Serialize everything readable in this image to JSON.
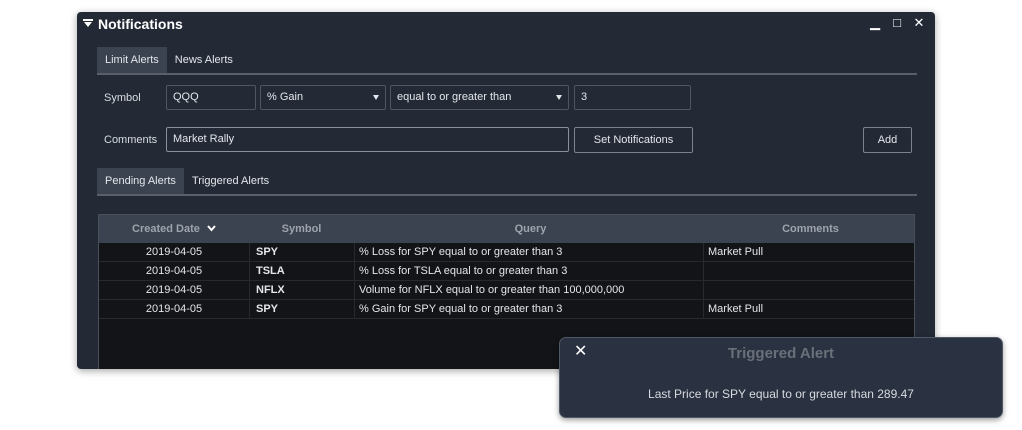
{
  "window": {
    "title": "Notifications",
    "controls": {
      "minimize": "▁",
      "maximize": "□",
      "close": "✕"
    }
  },
  "alert_tabs": [
    {
      "label": "Limit Alerts",
      "active": true
    },
    {
      "label": "News Alerts",
      "active": false
    }
  ],
  "form": {
    "symbol_label": "Symbol",
    "symbol_value": "QQQ",
    "metric_value": "%  Gain",
    "operator_value": "equal to or greater than",
    "threshold_value": "3",
    "comments_label": "Comments",
    "comments_value": "Market Rally",
    "set_notifications_label": "Set Notifications",
    "add_label": "Add"
  },
  "list_tabs": [
    {
      "label": "Pending Alerts",
      "active": true
    },
    {
      "label": "Triggered Alerts",
      "active": false
    }
  ],
  "table": {
    "headers": {
      "created_date": "Created Date",
      "symbol": "Symbol",
      "query": "Query",
      "comments": "Comments"
    },
    "rows": [
      {
        "date": "2019-04-05",
        "symbol": "SPY",
        "query": "%  Loss for SPY equal to or greater than 3",
        "comments": "Market Pull"
      },
      {
        "date": "2019-04-05",
        "symbol": "TSLA",
        "query": "%  Loss for TSLA equal to or greater than 3",
        "comments": ""
      },
      {
        "date": "2019-04-05",
        "symbol": "NFLX",
        "query": "Volume for NFLX equal to or greater than 100,000,000",
        "comments": ""
      },
      {
        "date": "2019-04-05",
        "symbol": "SPY",
        "query": "%  Gain for SPY equal to or greater than 3",
        "comments": "Market Pull"
      }
    ]
  },
  "toast": {
    "title": "Triggered Alert",
    "message": "Last Price for SPY equal to or greater than 289.47",
    "close": "✕"
  },
  "colors": {
    "window_bg": "#232a36",
    "tab_active": "#3b4350",
    "grid_bg": "#121417",
    "header_text": "#9ea4ad"
  }
}
